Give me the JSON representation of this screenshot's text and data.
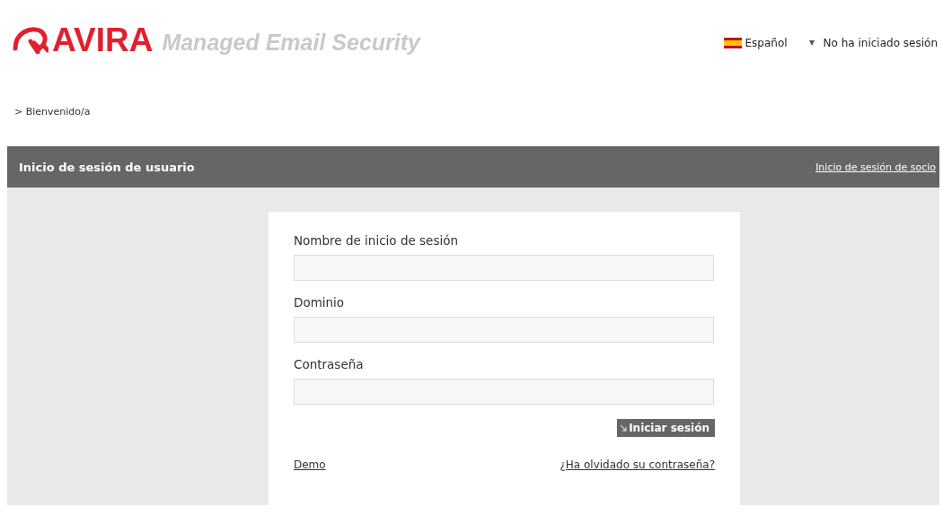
{
  "header": {
    "brand": "AVIRA",
    "product": "Managed Email Security",
    "language": "Español",
    "session_status": "No ha iniciado sesión"
  },
  "breadcrumb": "> Bienvenido/a",
  "panel": {
    "title": "Inicio de sesión de usuario",
    "partner_link": "Inicio de sesión de socio"
  },
  "form": {
    "fields": [
      {
        "label": "Nombre de inicio de sesión"
      },
      {
        "label": "Dominio"
      },
      {
        "label": "Contraseña"
      }
    ],
    "submit": "Iniciar sesión",
    "demo_link": "Demo",
    "forgot_link": "¿Ha olvidado su contraseña?"
  }
}
